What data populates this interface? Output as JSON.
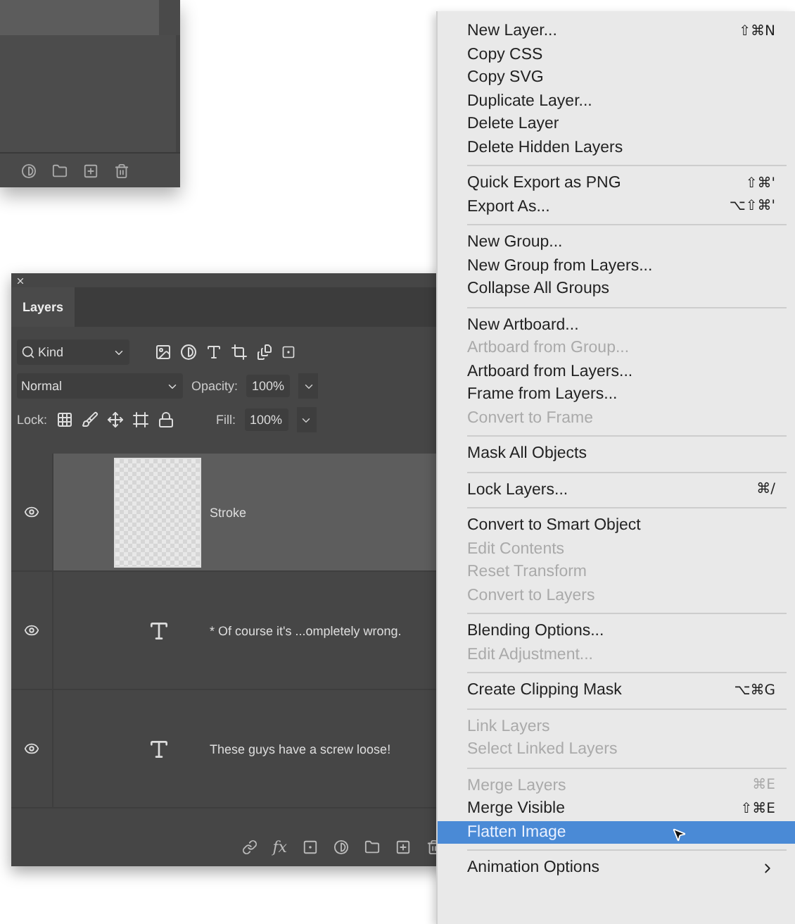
{
  "layers_panel": {
    "tabs": [
      {
        "label": "Layers",
        "selected": true
      }
    ],
    "filter": {
      "value": "Kind"
    },
    "blend_mode": {
      "value": "Normal"
    },
    "opacity": {
      "label": "Opacity:",
      "value": "100%"
    },
    "lock": {
      "label": "Lock:"
    },
    "fill": {
      "label": "Fill:",
      "value": "100%"
    },
    "layers": [
      {
        "name": "Stroke",
        "kind": "pixel",
        "selected": true,
        "visible": true
      },
      {
        "name": "* Of course it's ...ompletely wrong.",
        "kind": "text",
        "selected": false,
        "visible": true
      },
      {
        "name": "These guys have a screw loose!",
        "kind": "text",
        "selected": false,
        "visible": true
      }
    ],
    "footer_fx": "fx"
  },
  "context_menu": {
    "groups": [
      [
        {
          "label": "New Layer...",
          "shortcut": "⇧⌘N",
          "enabled": true,
          "selected": false,
          "submenu": false
        },
        {
          "label": "Copy CSS",
          "enabled": true,
          "selected": false,
          "submenu": false
        },
        {
          "label": "Copy SVG",
          "enabled": true,
          "selected": false,
          "submenu": false
        },
        {
          "label": "Duplicate Layer...",
          "enabled": true,
          "selected": false,
          "submenu": false
        },
        {
          "label": "Delete Layer",
          "enabled": true,
          "selected": false,
          "submenu": false
        },
        {
          "label": "Delete Hidden Layers",
          "enabled": true,
          "selected": false,
          "submenu": false
        }
      ],
      [
        {
          "label": "Quick Export as PNG",
          "shortcut": "⇧⌘'",
          "enabled": true,
          "selected": false,
          "submenu": false
        },
        {
          "label": "Export As...",
          "shortcut": "⌥⇧⌘'",
          "enabled": true,
          "selected": false,
          "submenu": false
        }
      ],
      [
        {
          "label": "New Group...",
          "enabled": true,
          "selected": false,
          "submenu": false
        },
        {
          "label": "New Group from Layers...",
          "enabled": true,
          "selected": false,
          "submenu": false
        },
        {
          "label": "Collapse All Groups",
          "enabled": true,
          "selected": false,
          "submenu": false
        }
      ],
      [
        {
          "label": "New Artboard...",
          "enabled": true,
          "selected": false,
          "submenu": false
        },
        {
          "label": "Artboard from Group...",
          "enabled": false,
          "selected": false,
          "submenu": false
        },
        {
          "label": "Artboard from Layers...",
          "enabled": true,
          "selected": false,
          "submenu": false
        },
        {
          "label": "Frame from Layers...",
          "enabled": true,
          "selected": false,
          "submenu": false
        },
        {
          "label": "Convert to Frame",
          "enabled": false,
          "selected": false,
          "submenu": false
        }
      ],
      [
        {
          "label": "Mask All Objects",
          "enabled": true,
          "selected": false,
          "submenu": false
        }
      ],
      [
        {
          "label": "Lock Layers...",
          "shortcut": "⌘/",
          "enabled": true,
          "selected": false,
          "submenu": false
        }
      ],
      [
        {
          "label": "Convert to Smart Object",
          "enabled": true,
          "selected": false,
          "submenu": false
        },
        {
          "label": "Edit Contents",
          "enabled": false,
          "selected": false,
          "submenu": false
        },
        {
          "label": "Reset Transform",
          "enabled": false,
          "selected": false,
          "submenu": false
        },
        {
          "label": "Convert to Layers",
          "enabled": false,
          "selected": false,
          "submenu": false
        }
      ],
      [
        {
          "label": "Blending Options...",
          "enabled": true,
          "selected": false,
          "submenu": false
        },
        {
          "label": "Edit Adjustment...",
          "enabled": false,
          "selected": false,
          "submenu": false
        }
      ],
      [
        {
          "label": "Create Clipping Mask",
          "shortcut": "⌥⌘G",
          "enabled": true,
          "selected": false,
          "submenu": false
        }
      ],
      [
        {
          "label": "Link Layers",
          "enabled": false,
          "selected": false,
          "submenu": false
        },
        {
          "label": "Select Linked Layers",
          "enabled": false,
          "selected": false,
          "submenu": false
        }
      ],
      [
        {
          "label": "Merge Layers",
          "shortcut": "⌘E",
          "enabled": false,
          "selected": false,
          "submenu": false
        },
        {
          "label": "Merge Visible",
          "shortcut": "⇧⌘E",
          "enabled": true,
          "selected": false,
          "submenu": false
        },
        {
          "label": "Flatten Image",
          "enabled": true,
          "selected": true,
          "submenu": false
        }
      ],
      [
        {
          "label": "Animation Options",
          "enabled": true,
          "selected": false,
          "submenu": true
        }
      ]
    ]
  }
}
